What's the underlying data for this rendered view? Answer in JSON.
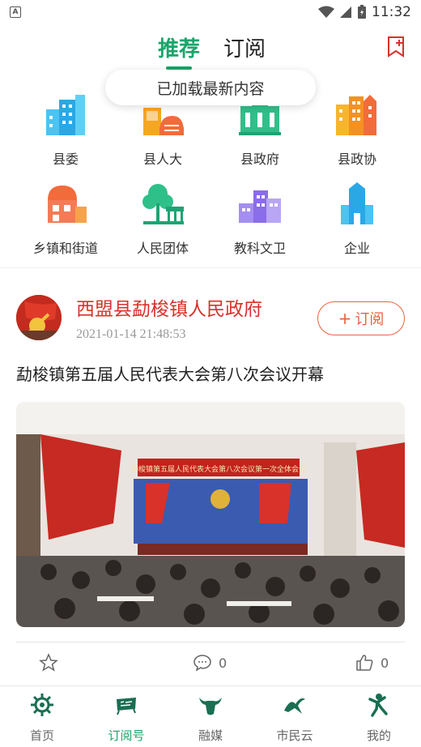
{
  "status": {
    "time": "11:32",
    "notification_icon": "a-icon"
  },
  "header": {
    "tabs": [
      {
        "label": "推荐",
        "active": true
      },
      {
        "label": "订阅",
        "active": false
      }
    ],
    "accent_color": "#1aa56a"
  },
  "toast": {
    "text": "已加载最新内容"
  },
  "categories": [
    {
      "label": "县委",
      "icon": "buildings-blue-icon"
    },
    {
      "label": "县人大",
      "icon": "hall-orange-icon"
    },
    {
      "label": "县政府",
      "icon": "government-building-icon"
    },
    {
      "label": "县政协",
      "icon": "tower-buildings-orange-icon"
    },
    {
      "label": "乡镇和街道",
      "icon": "town-house-icon"
    },
    {
      "label": "人民团体",
      "icon": "pavilion-tree-icon"
    },
    {
      "label": "教科文卫",
      "icon": "school-building-icon"
    },
    {
      "label": "企业",
      "icon": "company-tower-icon"
    }
  ],
  "card": {
    "source_name": "西盟县勐梭镇人民政府",
    "time": "2021-01-14 21:48:53",
    "subscribe_label": "订阅",
    "title": "勐梭镇第五届人民代表大会第八次会议开幕",
    "image_banner": "勐梭镇第五届人民代表大会第八次会议第一次全体会议",
    "comments": "0",
    "likes": "0"
  },
  "bottom_nav": [
    {
      "label": "首页",
      "icon": "gear-sun-icon",
      "active": false
    },
    {
      "label": "订阅号",
      "icon": "subscribe-icon",
      "active": true
    },
    {
      "label": "融媒",
      "icon": "bull-head-icon",
      "active": false
    },
    {
      "label": "市民云",
      "icon": "swallow-icon",
      "active": false
    },
    {
      "label": "我的",
      "icon": "dancer-icon",
      "active": false
    }
  ]
}
